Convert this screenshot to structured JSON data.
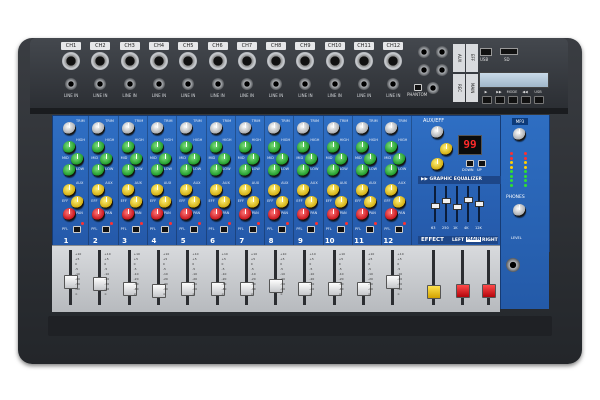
{
  "device": {
    "channel_labels": [
      "CH1",
      "CH2",
      "CH3",
      "CH4",
      "CH5",
      "CH6",
      "CH7",
      "CH8",
      "CH9",
      "CH10",
      "CH11",
      "CH12"
    ],
    "line_in_label": "LINE IN",
    "channel_numbers": [
      "1",
      "2",
      "3",
      "4",
      "5",
      "6",
      "7",
      "8",
      "9",
      "10",
      "11",
      "12"
    ],
    "knob_labels": {
      "trim": "TRIM",
      "high": "HIGH",
      "mid": "MID",
      "low": "LOW",
      "aux": "AUX",
      "eff": "EFF",
      "pan": "PAN",
      "pfl": "PFL"
    },
    "io_tags": [
      "AUX",
      "REC",
      "EFF",
      "MAIN"
    ],
    "usb_label": "USB",
    "sd_label": "SD",
    "media_buttons": [
      "▶",
      "▶▶",
      "MODE",
      "◀◀",
      "USB"
    ],
    "phantom_label": "PHANTOM",
    "aux_eff_label": "AUX/EFF",
    "effect_display": "99",
    "down_label": "DOWN",
    "up_label": "UP",
    "geq_title": "GRAPHIC EQUALIZER",
    "geq_bands": [
      "63",
      "250",
      "1K",
      "4K",
      "12K"
    ],
    "geq_positions": [
      0.55,
      0.4,
      0.6,
      0.35,
      0.5
    ],
    "mp3_label": "MP3",
    "phones_label": "PHONES",
    "level_label": "LEVEL",
    "effect_label": "EFFECT",
    "left_label": "LEFT",
    "main_label": "MAIN",
    "right_label": "RIGHT",
    "fader_positions": [
      0.55,
      0.6,
      0.7,
      0.75,
      0.7,
      0.7,
      0.7,
      0.65,
      0.7,
      0.7,
      0.7,
      0.55
    ],
    "master_fader_positions": [
      0.78,
      0.75,
      0.75
    ],
    "fader_scale": [
      "+10",
      "+5",
      "0",
      "-5",
      "-10",
      "-20",
      "-30",
      "-40",
      "∞"
    ],
    "colors": {
      "panel_blue": "#2b66ba",
      "chassis": "#2b2e33",
      "knob_green": "#1f9a2a",
      "knob_yellow": "#d2ad10",
      "knob_red": "#c8141c"
    }
  }
}
